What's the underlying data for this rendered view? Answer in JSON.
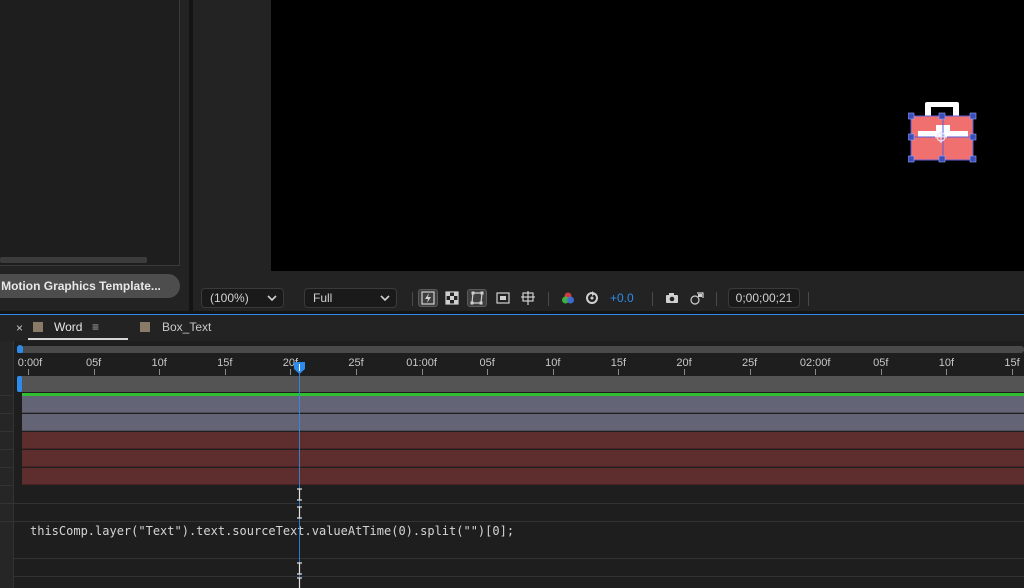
{
  "left_panel": {
    "export_button_label": "rt Motion Graphics Template..."
  },
  "viewer_toolbar": {
    "magnification_value": "(100%)",
    "resolution_value": "Full",
    "exposure_value": "+0.0",
    "timecode": "0;00;00;21"
  },
  "timeline_tabs": [
    {
      "label": "Word",
      "swatch_color": "#8a7a68",
      "active": true
    },
    {
      "label": "Box_Text",
      "swatch_color": "#8a7a68",
      "active": false
    }
  ],
  "tab_close_glyph": "×",
  "tab_menu_glyph": "≡",
  "ruler": {
    "labels": [
      "0:00f",
      "05f",
      "10f",
      "15f",
      "20f",
      "25f",
      "01:00f",
      "05f",
      "10f",
      "15f",
      "20f",
      "25f",
      "02:00f",
      "05f",
      "10f",
      "15f"
    ]
  },
  "expression_text": "thisComp.layer(\"Text\").text.sourceText.valueAtTime(0).split(\"\")[0];",
  "colors": {
    "accent": "#2d8ceb",
    "track_green": "#2fbf2f",
    "track_gray": "#636576",
    "track_red": "#5e2e2e",
    "shape_fill": "#f07070"
  },
  "icons": [
    "chevron-down-icon",
    "fast-previews-icon",
    "transparency-grid-icon",
    "mask-visibility-icon",
    "region-of-interest-icon",
    "guides-icon",
    "color-channels-icon",
    "reset-exposure-icon",
    "snapshot-icon",
    "show-snapshot-icon",
    "close-icon",
    "hamburger-menu-icon",
    "playhead-icon",
    "text-cursor-icon"
  ]
}
